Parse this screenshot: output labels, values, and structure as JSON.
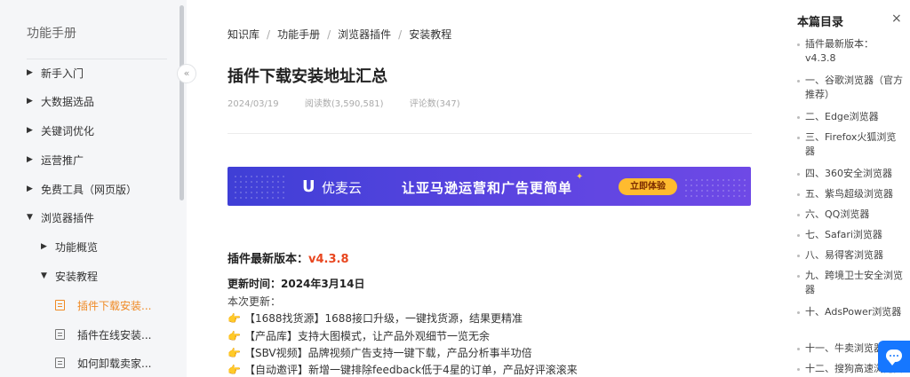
{
  "sidebar": {
    "title": "功能手册",
    "collapse_glyph": "«",
    "items": [
      {
        "label": "新手入门",
        "arrow": "▶"
      },
      {
        "label": "大数据选品",
        "arrow": "▶"
      },
      {
        "label": "关键词优化",
        "arrow": "▶"
      },
      {
        "label": "运营推广",
        "arrow": "▶"
      },
      {
        "label": "免费工具（网页版）",
        "arrow": "▶"
      },
      {
        "label": "浏览器插件",
        "arrow": "▼"
      },
      {
        "label": "功能概览",
        "arrow": "▶"
      },
      {
        "label": "安装教程",
        "arrow": "▼"
      },
      {
        "label": "插件下载安装..."
      },
      {
        "label": "插件在线安装..."
      },
      {
        "label": "如何卸载卖家..."
      }
    ]
  },
  "breadcrumb": [
    "知识库",
    "功能手册",
    "浏览器插件",
    "安装教程"
  ],
  "breadcrumb_sep": "/",
  "article": {
    "title": "插件下载安装地址汇总",
    "date": "2024/03/19",
    "reads": "阅读数(3,590,581)",
    "comments": "评论数(347)",
    "version_label": "插件最新版本：",
    "version": "v4.3.8",
    "update_time": "更新时间：2024年3月14日",
    "update_label": "本次更新：",
    "updates": [
      "【1688找货源】1688接口升级，一键找货源，结果更精准",
      "【产品库】支持大图模式，让产品外观细节一览无余",
      "【SBV视频】品牌视频广告支持一键下载，产品分析事半功倍",
      "【自动邀评】新增一键排除feedback低于4星的订单，产品好评滚滚来"
    ]
  },
  "banner": {
    "logo_mark": "U",
    "brand": "优麦云",
    "slogan": "让亚马逊运营和广告更简单",
    "cta": "立即体验"
  },
  "toc": {
    "title": "本篇目录",
    "close": "×",
    "items": [
      "插件最新版本：v4.3.8",
      "一、谷歌浏览器（官方推荐）",
      "二、Edge浏览器",
      "三、Firefox火狐浏览器",
      "四、360安全浏览器",
      "五、紫鸟超级浏览器",
      "六、QQ浏览器",
      "七、Safari浏览器",
      "八、易得客浏览器",
      "九、跨境卫士安全浏览器",
      "十、AdsPower浏览器",
      "十一、牛卖浏览器",
      "十二、搜狗高速浏览器"
    ]
  },
  "colors": {
    "accent_orange": "#f08a24",
    "version_red": "#e8461f",
    "chat_blue": "#1677ff"
  },
  "icons": {
    "update_bullet": "pointing-hand-icon",
    "chat": "chat-bubble-icon"
  },
  "hand_glyph": "👉"
}
